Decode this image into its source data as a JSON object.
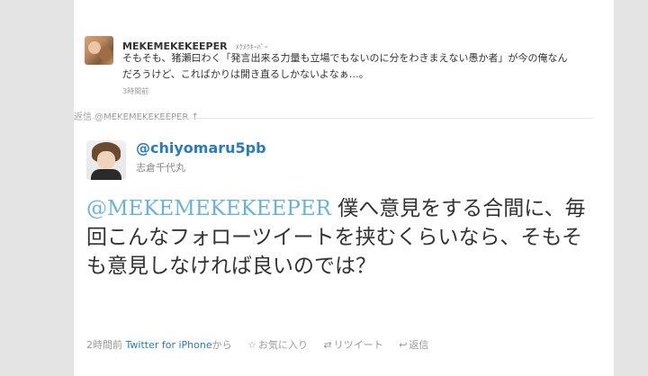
{
  "parent_tweet": {
    "screen_name": "MEKEMEKEKEEPER",
    "display_name": "ﾒｸﾒｸｷｰﾊﾟｰ",
    "text": "そもそも、猪瀬曰わく「発言出来る力量も立場でもないのに分をわきまえない愚か者」が今の俺なんだろうけど、こればかりは開き直るしかないよなぁ…。",
    "time": "3時間前"
  },
  "reply_to": "返信 @MEKEMEKEKEEPER ↑",
  "main_tweet": {
    "screen_name": "@chiyomaru5pb",
    "display_name": "志倉千代丸",
    "mention": "@MEKEMEKEKEEPER",
    "text": " 僕へ意見をする合間に、毎回こんなフォローツイートを挟むくらいなら、そもそも意見しなければ良いのでは？",
    "time": "2時間前",
    "source": "Twitter for iPhone",
    "source_suffix": "から",
    "actions": {
      "favorite_icon": "star-icon",
      "favorite": "お気に入り",
      "retweet_icon": "retweet-icon",
      "retweet": "リツイート",
      "reply_icon": "reply-icon",
      "reply": "返信"
    }
  }
}
